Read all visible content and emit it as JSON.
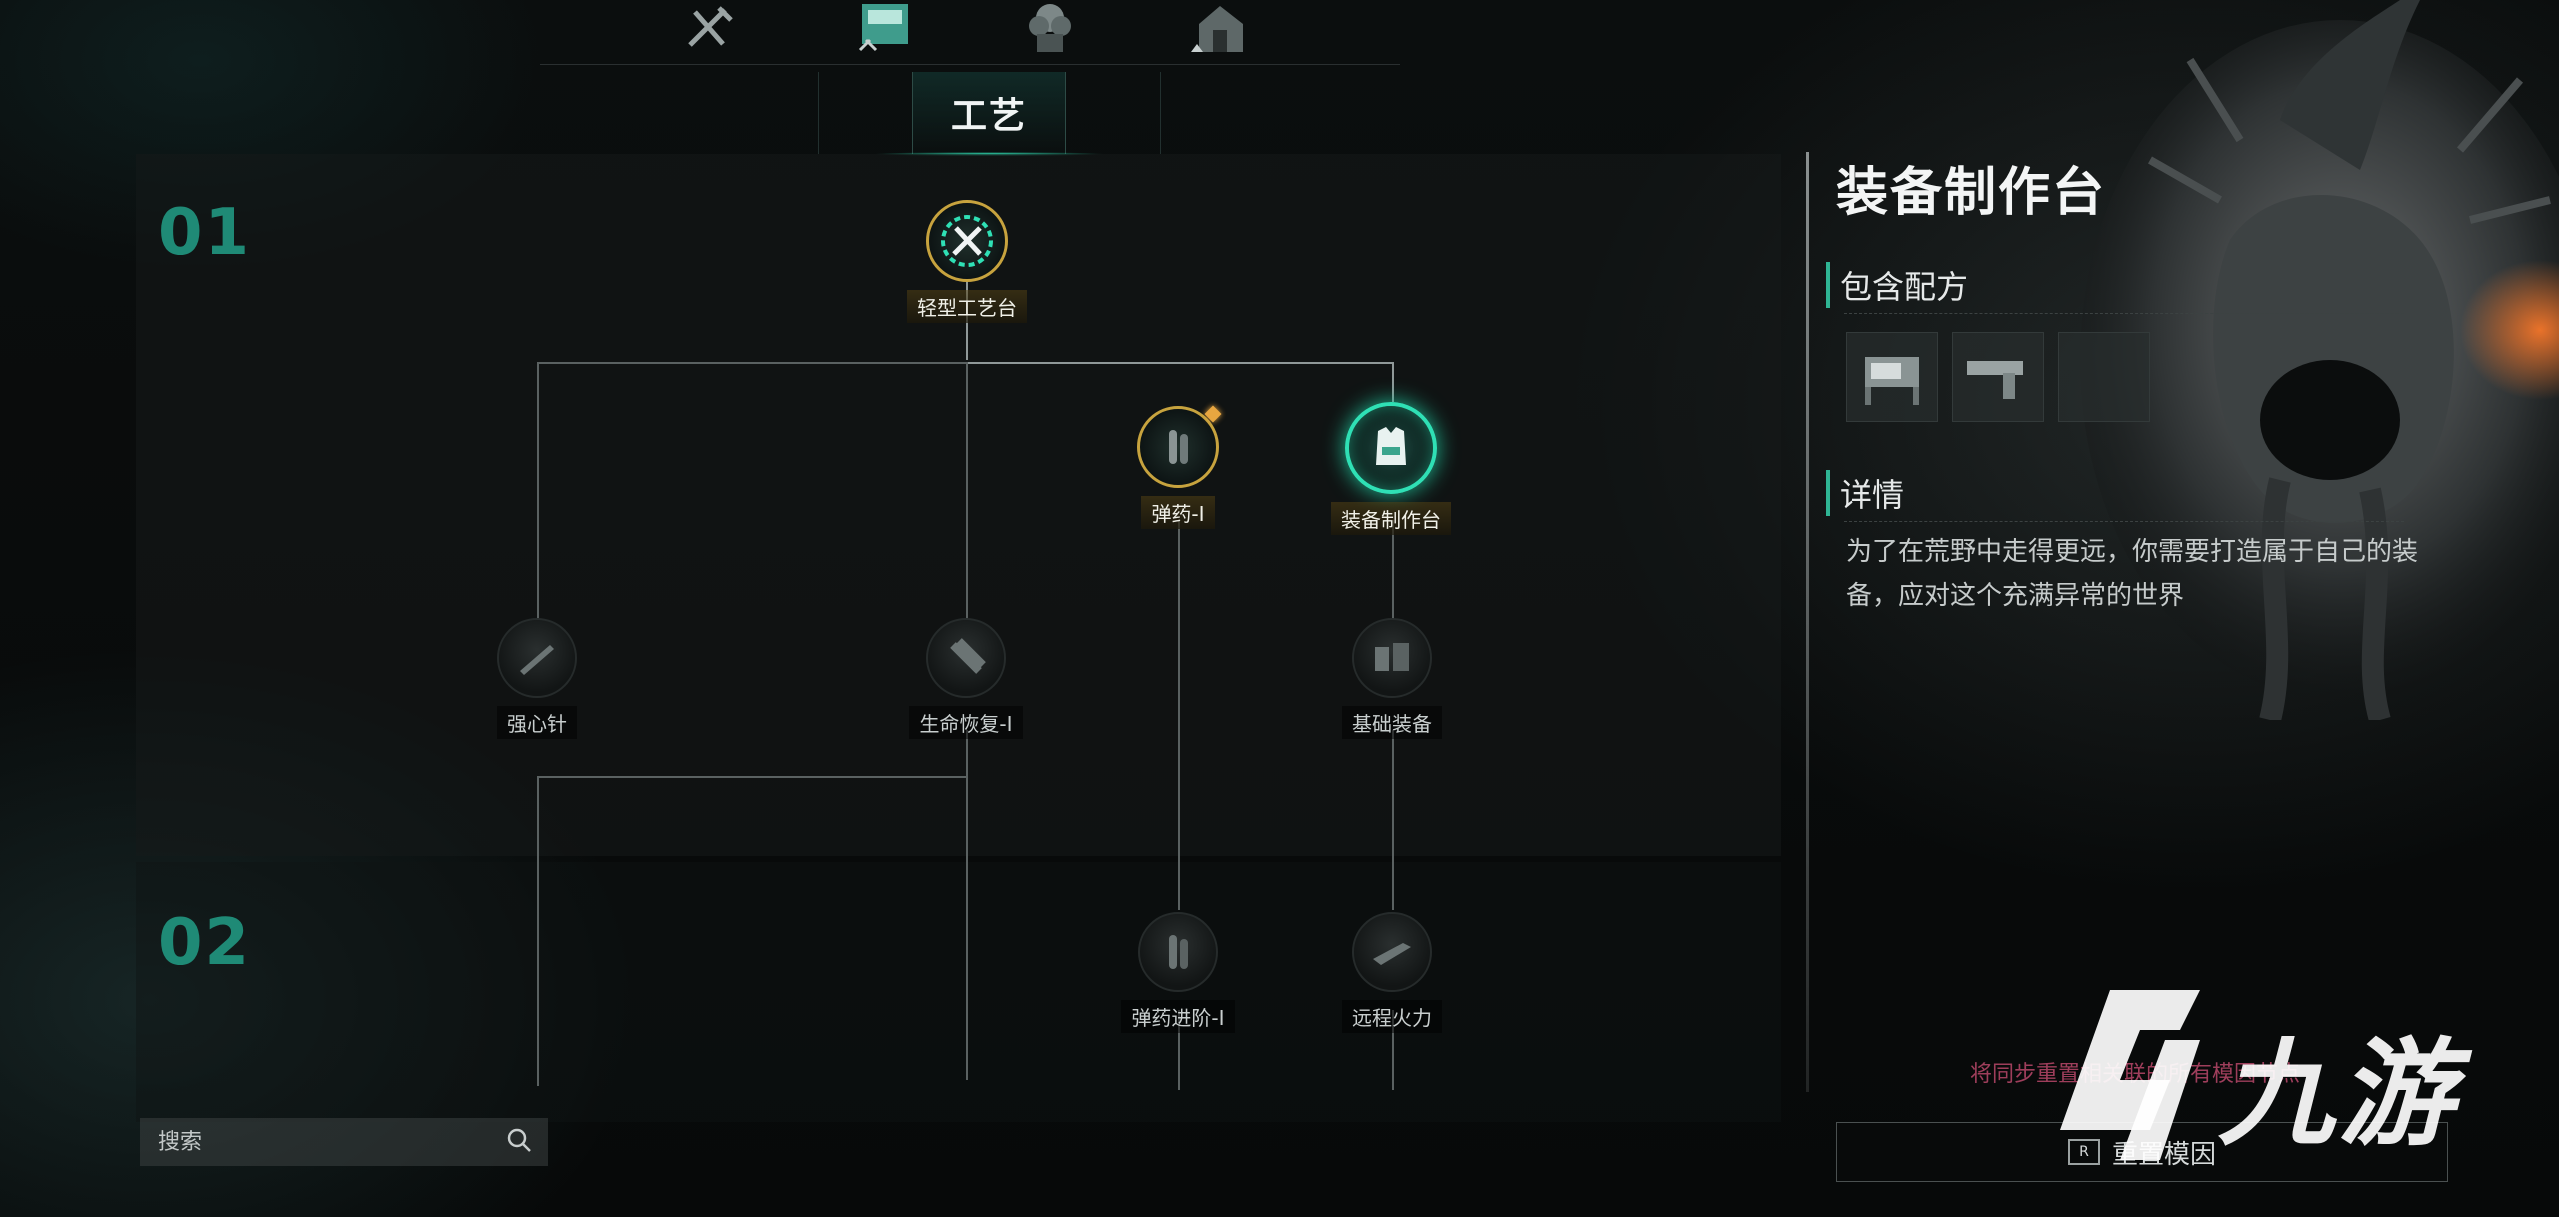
{
  "section_tab": {
    "label": "工艺"
  },
  "tiers": [
    {
      "number": "01"
    },
    {
      "number": "02"
    }
  ],
  "nodes": {
    "light_workbench": {
      "label": "轻型工艺台",
      "state": "unlocked"
    },
    "ammo_1": {
      "label": "弹药-I",
      "state": "unlocked",
      "badge": "new"
    },
    "equipment_workbench": {
      "label": "装备制作台",
      "state": "selected"
    },
    "stimulant": {
      "label": "强心针",
      "state": "locked"
    },
    "health_restore_1": {
      "label": "生命恢复-I",
      "state": "locked"
    },
    "basic_equipment": {
      "label": "基础装备",
      "state": "locked"
    },
    "ammo_advanced_1": {
      "label": "弹药进阶-I",
      "state": "locked"
    },
    "ranged_firepower": {
      "label": "远程火力",
      "state": "locked"
    }
  },
  "search": {
    "placeholder": "搜索"
  },
  "detail": {
    "title": "装备制作台",
    "recipes_heading": "包含配方",
    "details_heading": "详情",
    "description": "为了在荒野中走得更远，你需要打造属于自己的装备，应对这个充满异常的世界"
  },
  "reset": {
    "note": "将同步重置相关联的所有模因节点",
    "button_label": "重置模因",
    "key_hint": "R"
  },
  "watermark": {
    "text": "九游"
  },
  "colors": {
    "accent": "#2fe0b5",
    "tier_number": "#1f8a76",
    "unlocked_ring": "#c7a33e",
    "badge": "#e8a640",
    "reset_note": "#b9486a"
  },
  "icons": {
    "top_nav": [
      "crafting-tools-icon",
      "workstation-icon",
      "plant-icon",
      "base-icon"
    ],
    "recipes": [
      "workbench-icon",
      "weapon-icon",
      "blank-recipe-icon"
    ]
  }
}
